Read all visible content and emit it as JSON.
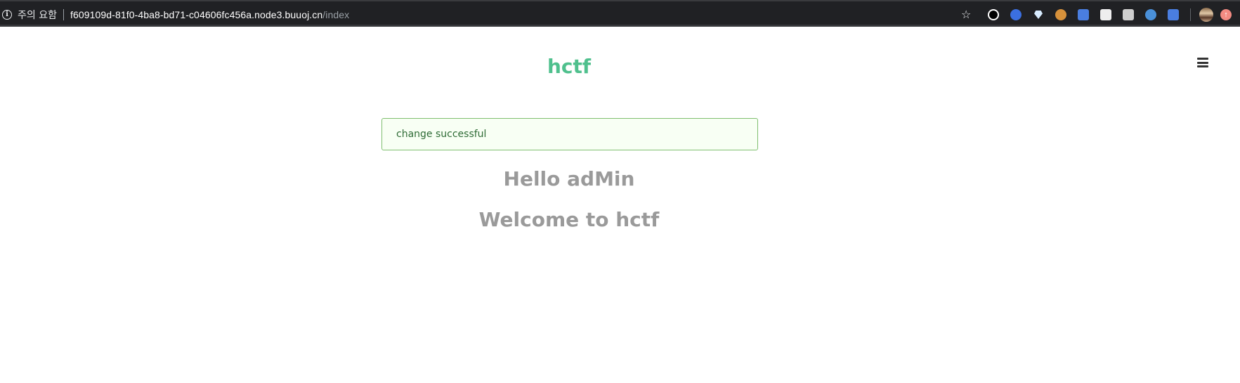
{
  "browser": {
    "security_label": "주의 요함",
    "url_host": "f609109d-81f0-4ba8-bd71-c04606fc456a.node3.buuoj.cn",
    "url_path": "/index",
    "icons": [
      "info-icon",
      "star-icon",
      "record-icon",
      "bookmark-icon",
      "diamond-icon",
      "cookie-icon",
      "translate-icon",
      "document-icon",
      "printer-icon",
      "globe-icon",
      "doc-search-icon",
      "avatar",
      "update-icon"
    ]
  },
  "page": {
    "title": "hctf",
    "alert": "change successful",
    "greeting": "Hello adMin",
    "welcome": "Welcome to hctf"
  },
  "colors": {
    "title": "#4fc08d",
    "alert_bg": "#f8fff4",
    "alert_border": "#7fbf6f",
    "alert_text": "#2e6b35",
    "heading_text": "#9a9a9a"
  }
}
